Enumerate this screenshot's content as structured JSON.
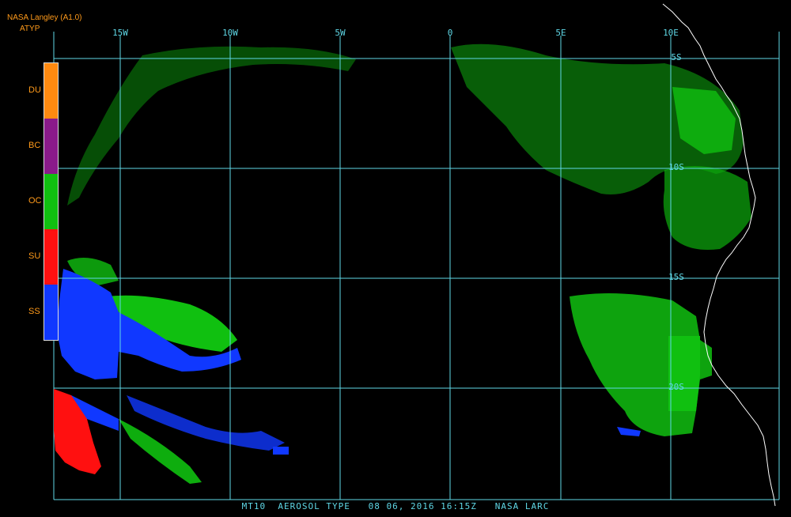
{
  "header": {
    "source": "NASA Langley (A1.0)",
    "product": "ATYP"
  },
  "legend": {
    "items": [
      {
        "label": "DU",
        "color": "#ff8a10"
      },
      {
        "label": "BC",
        "color": "#8a1a8a"
      },
      {
        "label": "OC",
        "color": "#10c010"
      },
      {
        "label": "SU",
        "color": "#ff1010"
      },
      {
        "label": "SS",
        "color": "#1038ff"
      }
    ]
  },
  "map": {
    "grid_color": "#5fd7e6",
    "coast_color": "#ffffff",
    "longitude_labels": [
      "15W",
      "10W",
      "5W",
      "0",
      "5E",
      "10E"
    ],
    "latitude_labels": [
      "5S",
      "10S",
      "15S",
      "20S"
    ]
  },
  "footer": {
    "caption": "MT10  AEROSOL TYPE   08 06, 2016 16:15Z   NASA LARC"
  }
}
